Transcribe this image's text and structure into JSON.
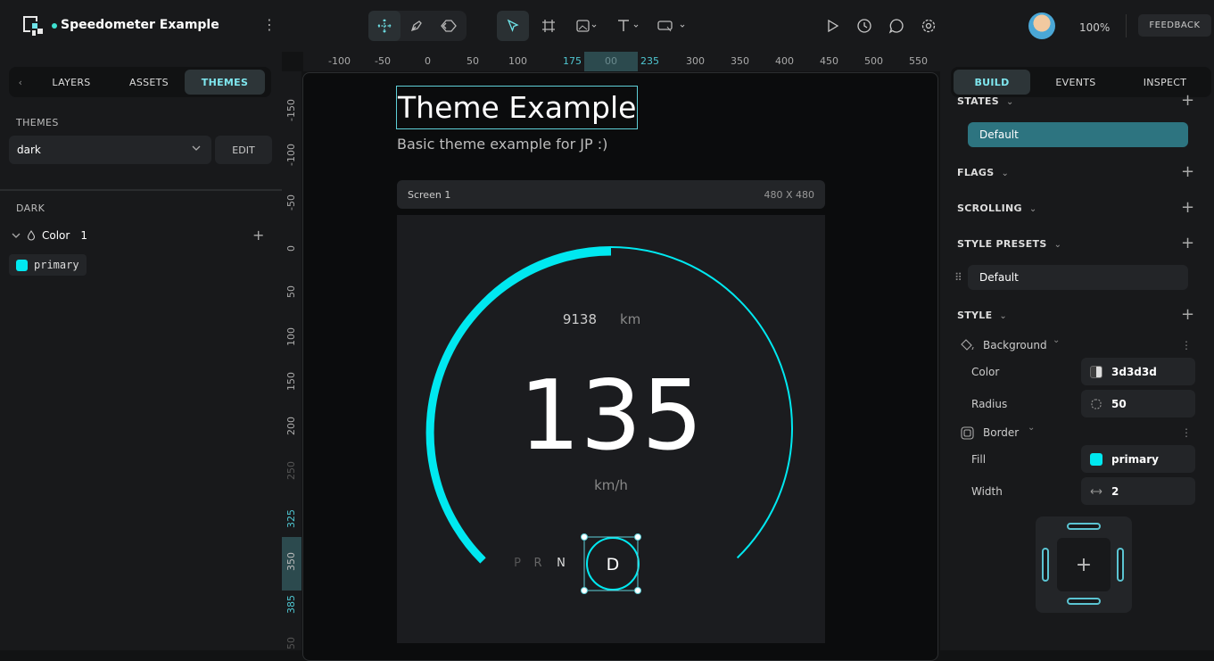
{
  "topbar": {
    "project_title": "Speedometer Example",
    "zoom": "100%",
    "feedback_label": "FEEDBACK",
    "tools": [
      "move-tool-icon",
      "pen-tool-icon",
      "component-tool-icon",
      "select-tool-icon",
      "frame-tool-icon",
      "image-tool-icon",
      "text-tool-icon",
      "widget-tool-icon"
    ],
    "actions": [
      "play-icon",
      "history-icon",
      "comment-icon",
      "settings-icon"
    ]
  },
  "left": {
    "tabs": [
      "LAYERS",
      "ASSETS",
      "THEMES"
    ],
    "active_tab": "THEMES",
    "themes_label": "THEMES",
    "theme_select": "dark",
    "edit_label": "EDIT",
    "group_label": "DARK",
    "color_label": "Color",
    "color_count": "1",
    "chip_label": "primary",
    "chip_color": "#00e8f0"
  },
  "rulers": {
    "h": [
      "-100",
      "-50",
      "0",
      "50",
      "100",
      "175",
      "00",
      "235",
      "300",
      "350",
      "400",
      "450",
      "500",
      "550"
    ],
    "v": [
      "-150",
      "-100",
      "-50",
      "0",
      "50",
      "100",
      "150",
      "200",
      "250",
      "325",
      "350",
      "385",
      "50"
    ]
  },
  "canvas": {
    "title": "Theme Example",
    "subtitle": "Basic theme example for JP :)",
    "screen_name": "Screen 1",
    "screen_size": "480 X 480",
    "odometer_value": "9138",
    "odometer_unit": "km",
    "speed": "135",
    "speed_unit": "km/h",
    "gears": [
      "P",
      "R",
      "N"
    ],
    "active_gear": "D",
    "accent": "#00e8f0",
    "speed_fraction": 0.5
  },
  "right": {
    "tabs": [
      "BUILD",
      "EVENTS",
      "INSPECT"
    ],
    "active_tab": "BUILD",
    "states_label": "STATES",
    "state_default": "Default",
    "flags_label": "FLAGS",
    "scrolling_label": "SCROLLING",
    "presets_label": "STYLE PRESETS",
    "preset_default": "Default",
    "style_label": "STYLE",
    "background_label": "Background",
    "color_label": "Color",
    "color_value": "3d3d3d",
    "radius_label": "Radius",
    "radius_value": "50",
    "border_label": "Border",
    "fill_label": "Fill",
    "fill_value": "primary",
    "width_label": "Width",
    "width_value": "2"
  }
}
